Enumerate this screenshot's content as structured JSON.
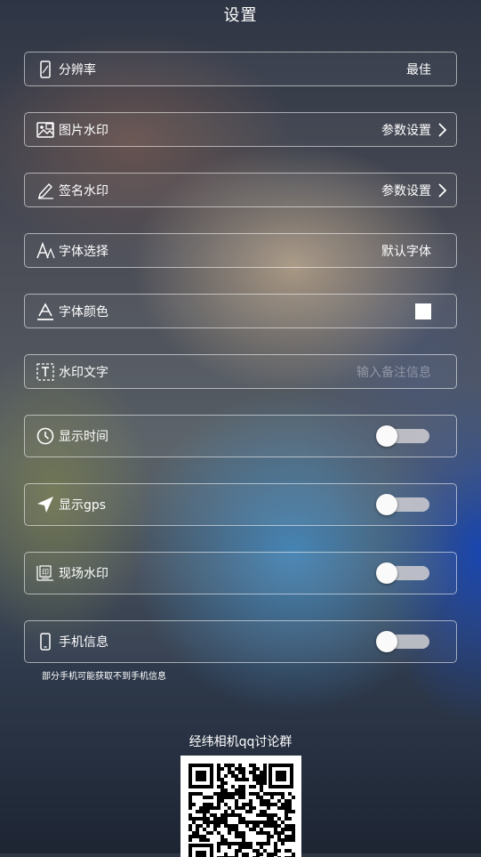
{
  "header": {
    "title": "设置"
  },
  "settings": {
    "resolution": {
      "label": "分辨率",
      "value": "最佳",
      "icon": "phone-screen-icon"
    },
    "image_watermark": {
      "label": "图片水印",
      "value": "参数设置",
      "icon": "image-watermark-icon"
    },
    "signature_watermark": {
      "label": "签名水印",
      "value": "参数设置",
      "icon": "pen-signature-icon"
    },
    "font_select": {
      "label": "字体选择",
      "value": "默认字体",
      "icon": "font-icon"
    },
    "font_color": {
      "label": "字体颜色",
      "icon": "font-color-icon",
      "swatch_color": "#ffffff"
    },
    "watermark_text": {
      "label": "水印文字",
      "placeholder": "输入备注信息",
      "icon": "text-box-icon"
    },
    "show_time": {
      "label": "显示时间",
      "on": false,
      "icon": "clock-icon"
    },
    "show_gps": {
      "label": "显示gps",
      "on": false,
      "icon": "location-arrow-icon"
    },
    "site_watermark": {
      "label": "现场水印",
      "on": false,
      "icon": "stamp-icon"
    },
    "phone_info": {
      "label": "手机信息",
      "on": false,
      "icon": "phone-icon"
    }
  },
  "note": "部分手机可能获取不到手机信息",
  "qr": {
    "title": "经纬相机qq讨论群"
  },
  "colors": {
    "text": "#ffffff",
    "border": "rgba(255,255,255,0.55)",
    "toggle_track": "#c8c8cd",
    "toggle_knob": "#fafafa"
  }
}
